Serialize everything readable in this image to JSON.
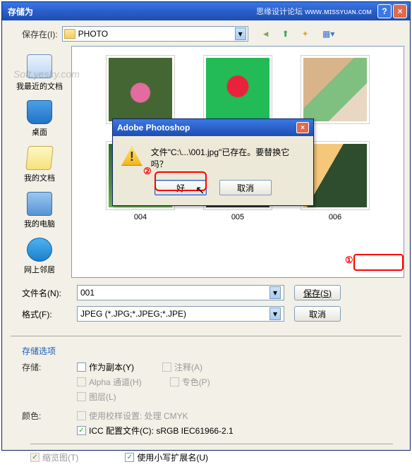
{
  "titlebar": {
    "title": "存储为",
    "brand": "思缘设计论坛 ᴡᴡᴡ.ᴍɪssʏᴜᴀɴ.ᴄᴏᴍ"
  },
  "toolbar": {
    "save_in_label": "保存在(I):",
    "location": "PHOTO"
  },
  "places": {
    "recent": "我最近的文档",
    "desktop": "桌面",
    "mydocs": "我的文档",
    "mycomp": "我的电脑",
    "network": "网上邻居"
  },
  "thumbs": [
    "004",
    "005",
    "006"
  ],
  "watermark": "Soft.yesky.com",
  "fields": {
    "filename_label": "文件名(N):",
    "filename_value": "001",
    "format_label": "格式(F):",
    "format_value": "JPEG (*.JPG;*.JPEG;*.JPE)"
  },
  "buttons": {
    "save": "保存(S)",
    "cancel": "取消"
  },
  "options": {
    "section_title": "存储选项",
    "save_label": "存储:",
    "as_copy": "作为副本(Y)",
    "annotations": "注释(A)",
    "alpha": "Alpha 通道(H)",
    "spot": "专色(P)",
    "layers": "图层(L)",
    "color_label": "颜色:",
    "proof": "使用校样设置: 处理 CMYK",
    "icc": "ICC 配置文件(C): sRGB IEC61966-2.1",
    "thumbnail": "缩览图(T)",
    "lowercase_ext": "使用小写扩展名(U)"
  },
  "modal": {
    "title": "Adobe Photoshop",
    "message": "文件\"C:\\...\\001.jpg\"已存在。要替换它吗？",
    "ok": "好",
    "cancel": "取消"
  },
  "markers": {
    "one": "①",
    "two": "②"
  }
}
